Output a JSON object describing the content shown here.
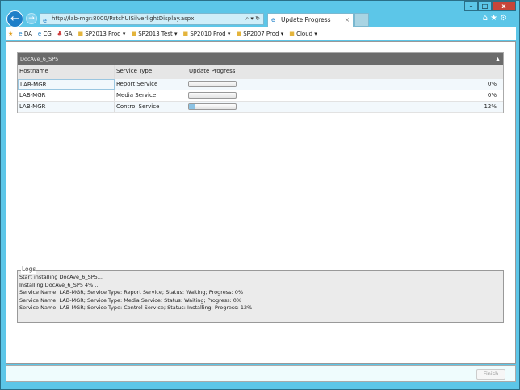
{
  "browser": {
    "url": "http://lab-mgr:8000/PatchUISilverlightDisplay.aspx",
    "tab_title": "Update Progress",
    "favorites": [
      {
        "label": "DA",
        "type": "page"
      },
      {
        "label": "CG",
        "type": "page"
      },
      {
        "label": "GA",
        "type": "page"
      },
      {
        "label": "SP2013 Prod",
        "type": "folder"
      },
      {
        "label": "SP2013 Test",
        "type": "folder"
      },
      {
        "label": "SP2010 Prod",
        "type": "folder"
      },
      {
        "label": "SP2007 Prod",
        "type": "folder"
      },
      {
        "label": "Cloud",
        "type": "folder"
      }
    ]
  },
  "panel": {
    "title": "DocAve_6_SP5",
    "columns": [
      "Hostname",
      "Service Type",
      "Update Progress"
    ],
    "rows": [
      {
        "host": "LAB-MGR",
        "service": "Report Service",
        "progress": 0,
        "progress_label": "0%"
      },
      {
        "host": "LAB-MGR",
        "service": "Media Service",
        "progress": 0,
        "progress_label": "0%"
      },
      {
        "host": "LAB-MGR",
        "service": "Control Service",
        "progress": 12,
        "progress_label": "12%"
      }
    ]
  },
  "logs": {
    "title": "Logs",
    "lines": [
      "Start installing DocAve_6_SP5...",
      "Installing DocAve_6_SP5 4%...",
      "Service Name: LAB-MGR; Service Type: Report Service; Status: Waiting; Progress: 0%",
      "Service Name: LAB-MGR; Service Type: Media Service; Status: Waiting; Progress: 0%",
      "Service Name: LAB-MGR; Service Type: Control Service; Status: Installing; Progress: 12%"
    ]
  },
  "footer": {
    "finish_label": "Finish"
  },
  "colors": {
    "frame": "#5cc6e8",
    "panel_header": "#6b6b6b",
    "progress_fill": "#8cc3e4"
  }
}
